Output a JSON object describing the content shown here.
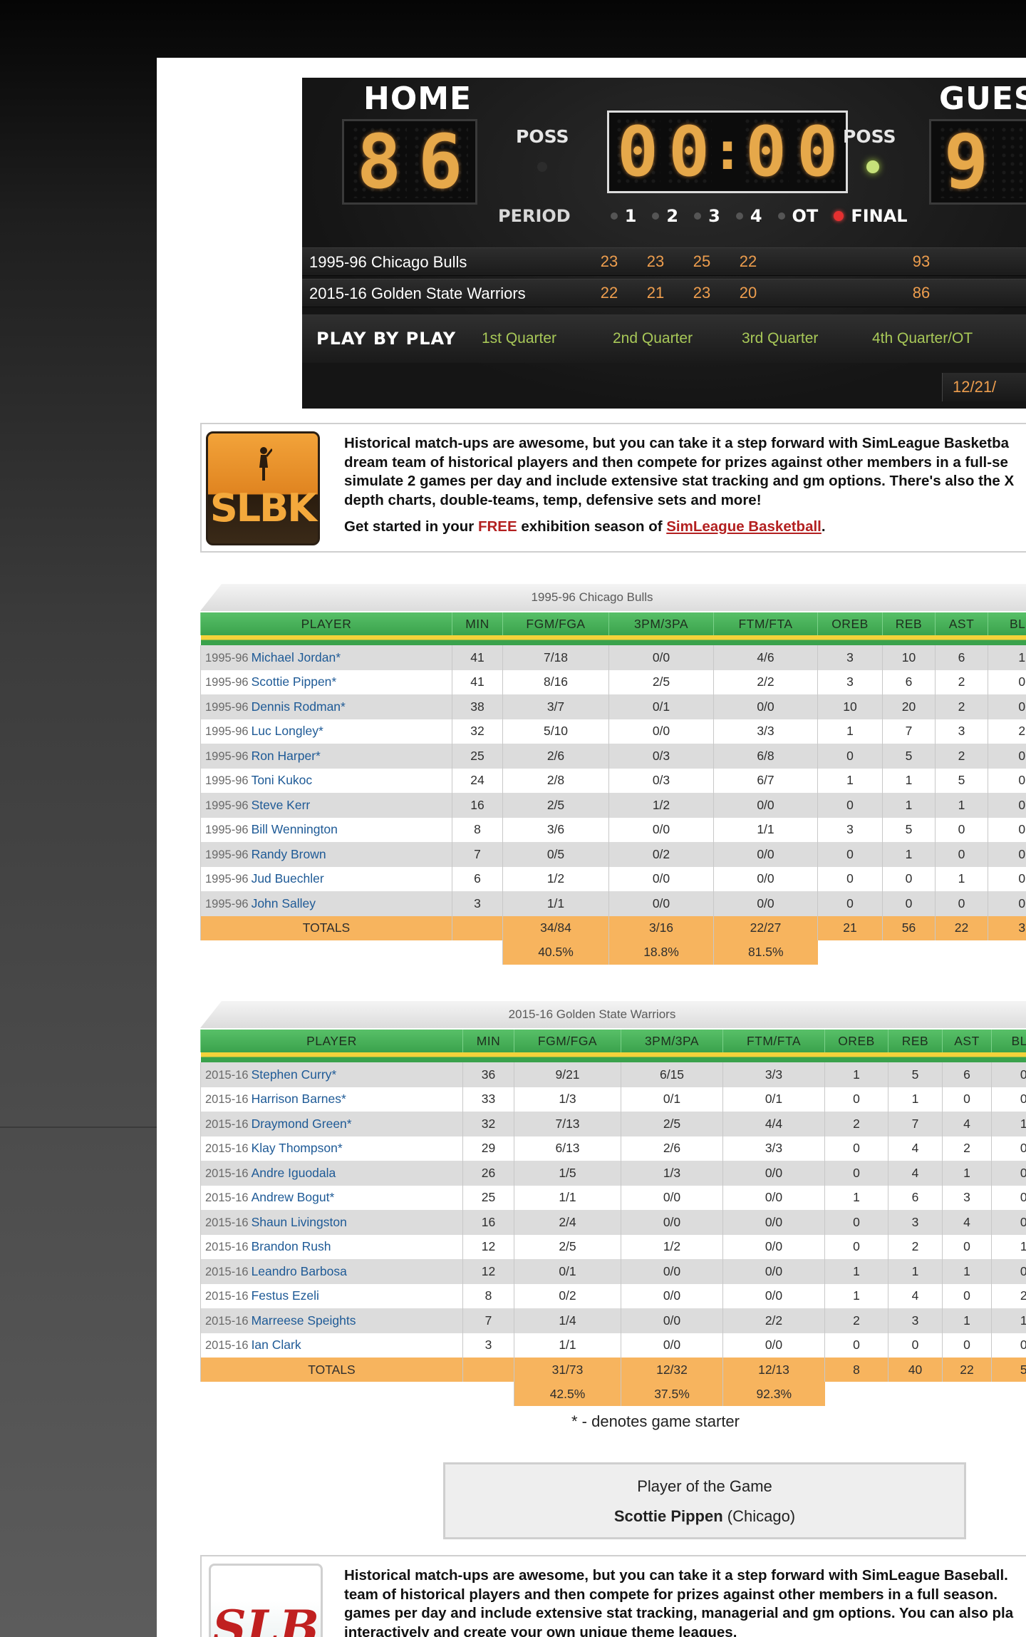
{
  "scoreboard": {
    "home_label": "HOME",
    "guest_label": "GUES",
    "home_digits": [
      "8",
      "6"
    ],
    "guest_digits": [
      "9"
    ],
    "clock_digits": [
      "0",
      "0",
      "0",
      "0"
    ],
    "poss_label": "POSS",
    "period_label": "PERIOD",
    "periods": [
      "1",
      "2",
      "3",
      "4",
      "OT",
      "FINAL"
    ],
    "teams": [
      {
        "name": "1995-96 Chicago Bulls",
        "q": [
          "23",
          "23",
          "25",
          "22"
        ],
        "total": "93"
      },
      {
        "name": "2015-16 Golden State Warriors",
        "q": [
          "22",
          "21",
          "23",
          "20"
        ],
        "total": "86"
      }
    ],
    "pbp_title": "PLAY BY PLAY",
    "pbp_links": [
      "1st Quarter",
      "2nd Quarter",
      "3rd Quarter",
      "4th Quarter/OT"
    ],
    "date": "12/21/"
  },
  "promo1": {
    "lines": [
      "Historical match-ups are awesome, but you can take it a step forward with SimLeague Basketba",
      "dream team of historical players and then compete for prizes against other members in a full-se",
      "simulate 2 games per day and include extensive stat tracking and gm options. There's also the X",
      "depth charts, double-teams, temp, defensive sets and more!"
    ],
    "cta_prefix": "Get started in your ",
    "cta_free": "FREE",
    "cta_middle": " exhibition season of ",
    "cta_link": "SimLeague Basketball",
    "cta_suffix": ".",
    "logo_text": "SLBK"
  },
  "table1": {
    "title": "1995-96 Chicago Bulls",
    "headers": [
      "PLAYER",
      "MIN",
      "FGM/FGA",
      "3PM/3PA",
      "FTM/FTA",
      "OREB",
      "REB",
      "AST",
      "BLK"
    ],
    "rows": [
      {
        "yr": "1995-96",
        "name": "Michael Jordan*",
        "min": "41",
        "fg": "7/18",
        "tp": "0/0",
        "ft": "4/6",
        "oreb": "3",
        "reb": "10",
        "ast": "6",
        "blk": "1"
      },
      {
        "yr": "1995-96",
        "name": "Scottie Pippen*",
        "min": "41",
        "fg": "8/16",
        "tp": "2/5",
        "ft": "2/2",
        "oreb": "3",
        "reb": "6",
        "ast": "2",
        "blk": "0"
      },
      {
        "yr": "1995-96",
        "name": "Dennis Rodman*",
        "min": "38",
        "fg": "3/7",
        "tp": "0/1",
        "ft": "0/0",
        "oreb": "10",
        "reb": "20",
        "ast": "2",
        "blk": "0"
      },
      {
        "yr": "1995-96",
        "name": "Luc Longley*",
        "min": "32",
        "fg": "5/10",
        "tp": "0/0",
        "ft": "3/3",
        "oreb": "1",
        "reb": "7",
        "ast": "3",
        "blk": "2"
      },
      {
        "yr": "1995-96",
        "name": "Ron Harper*",
        "min": "25",
        "fg": "2/6",
        "tp": "0/3",
        "ft": "6/8",
        "oreb": "0",
        "reb": "5",
        "ast": "2",
        "blk": "0"
      },
      {
        "yr": "1995-96",
        "name": "Toni Kukoc",
        "min": "24",
        "fg": "2/8",
        "tp": "0/3",
        "ft": "6/7",
        "oreb": "1",
        "reb": "1",
        "ast": "5",
        "blk": "0"
      },
      {
        "yr": "1995-96",
        "name": "Steve Kerr",
        "min": "16",
        "fg": "2/5",
        "tp": "1/2",
        "ft": "0/0",
        "oreb": "0",
        "reb": "1",
        "ast": "1",
        "blk": "0"
      },
      {
        "yr": "1995-96",
        "name": "Bill Wennington",
        "min": "8",
        "fg": "3/6",
        "tp": "0/0",
        "ft": "1/1",
        "oreb": "3",
        "reb": "5",
        "ast": "0",
        "blk": "0"
      },
      {
        "yr": "1995-96",
        "name": "Randy Brown",
        "min": "7",
        "fg": "0/5",
        "tp": "0/2",
        "ft": "0/0",
        "oreb": "0",
        "reb": "1",
        "ast": "0",
        "blk": "0"
      },
      {
        "yr": "1995-96",
        "name": "Jud Buechler",
        "min": "6",
        "fg": "1/2",
        "tp": "0/0",
        "ft": "0/0",
        "oreb": "0",
        "reb": "0",
        "ast": "1",
        "blk": "0"
      },
      {
        "yr": "1995-96",
        "name": "John Salley",
        "min": "3",
        "fg": "1/1",
        "tp": "0/0",
        "ft": "0/0",
        "oreb": "0",
        "reb": "0",
        "ast": "0",
        "blk": "0"
      }
    ],
    "totals": {
      "label": "TOTALS",
      "fg": "34/84",
      "tp": "3/16",
      "ft": "22/27",
      "oreb": "21",
      "reb": "56",
      "ast": "22",
      "blk": "3"
    },
    "pct": {
      "fg": "40.5%",
      "tp": "18.8%",
      "ft": "81.5%"
    }
  },
  "table2": {
    "title": "2015-16 Golden State Warriors",
    "headers": [
      "PLAYER",
      "MIN",
      "FGM/FGA",
      "3PM/3PA",
      "FTM/FTA",
      "OREB",
      "REB",
      "AST",
      "BLK"
    ],
    "rows": [
      {
        "yr": "2015-16",
        "name": "Stephen Curry*",
        "min": "36",
        "fg": "9/21",
        "tp": "6/15",
        "ft": "3/3",
        "oreb": "1",
        "reb": "5",
        "ast": "6",
        "blk": "0"
      },
      {
        "yr": "2015-16",
        "name": "Harrison Barnes*",
        "min": "33",
        "fg": "1/3",
        "tp": "0/1",
        "ft": "0/1",
        "oreb": "0",
        "reb": "1",
        "ast": "0",
        "blk": "0"
      },
      {
        "yr": "2015-16",
        "name": "Draymond Green*",
        "min": "32",
        "fg": "7/13",
        "tp": "2/5",
        "ft": "4/4",
        "oreb": "2",
        "reb": "7",
        "ast": "4",
        "blk": "1"
      },
      {
        "yr": "2015-16",
        "name": "Klay Thompson*",
        "min": "29",
        "fg": "6/13",
        "tp": "2/6",
        "ft": "3/3",
        "oreb": "0",
        "reb": "4",
        "ast": "2",
        "blk": "0"
      },
      {
        "yr": "2015-16",
        "name": "Andre Iguodala",
        "min": "26",
        "fg": "1/5",
        "tp": "1/3",
        "ft": "0/0",
        "oreb": "0",
        "reb": "4",
        "ast": "1",
        "blk": "0"
      },
      {
        "yr": "2015-16",
        "name": "Andrew Bogut*",
        "min": "25",
        "fg": "1/1",
        "tp": "0/0",
        "ft": "0/0",
        "oreb": "1",
        "reb": "6",
        "ast": "3",
        "blk": "0"
      },
      {
        "yr": "2015-16",
        "name": "Shaun Livingston",
        "min": "16",
        "fg": "2/4",
        "tp": "0/0",
        "ft": "0/0",
        "oreb": "0",
        "reb": "3",
        "ast": "4",
        "blk": "0"
      },
      {
        "yr": "2015-16",
        "name": "Brandon Rush",
        "min": "12",
        "fg": "2/5",
        "tp": "1/2",
        "ft": "0/0",
        "oreb": "0",
        "reb": "2",
        "ast": "0",
        "blk": "1"
      },
      {
        "yr": "2015-16",
        "name": "Leandro Barbosa",
        "min": "12",
        "fg": "0/1",
        "tp": "0/0",
        "ft": "0/0",
        "oreb": "1",
        "reb": "1",
        "ast": "1",
        "blk": "0"
      },
      {
        "yr": "2015-16",
        "name": "Festus Ezeli",
        "min": "8",
        "fg": "0/2",
        "tp": "0/0",
        "ft": "0/0",
        "oreb": "1",
        "reb": "4",
        "ast": "0",
        "blk": "2"
      },
      {
        "yr": "2015-16",
        "name": "Marreese Speights",
        "min": "7",
        "fg": "1/4",
        "tp": "0/0",
        "ft": "2/2",
        "oreb": "2",
        "reb": "3",
        "ast": "1",
        "blk": "1"
      },
      {
        "yr": "2015-16",
        "name": "Ian Clark",
        "min": "3",
        "fg": "1/1",
        "tp": "0/0",
        "ft": "0/0",
        "oreb": "0",
        "reb": "0",
        "ast": "0",
        "blk": "0"
      }
    ],
    "totals": {
      "label": "TOTALS",
      "fg": "31/73",
      "tp": "12/32",
      "ft": "12/13",
      "oreb": "8",
      "reb": "40",
      "ast": "22",
      "blk": "5"
    },
    "pct": {
      "fg": "42.5%",
      "tp": "37.5%",
      "ft": "92.3%"
    }
  },
  "starter_note": "* - denotes game starter",
  "potg": {
    "title": "Player of the Game",
    "player": "Scottie Pippen",
    "team": " (Chicago)"
  },
  "promo2": {
    "lines": [
      "Historical match-ups are awesome, but you can take it a step forward with SimLeague Baseball.",
      "team of historical players and then compete for prizes against other members in a full season.",
      "games per day and include extensive stat tracking, managerial and gm options. You can also pla",
      "interactively and create your own unique theme leagues."
    ],
    "logo_text": "SLB"
  },
  "colors": {
    "table_header_green": "#3aa24c",
    "totals_orange": "#f7b45e",
    "player_link": "#1e5a96",
    "score_amber": "#ee9e4e",
    "pbp_link": "#a8c858",
    "free_red": "#b32020"
  }
}
